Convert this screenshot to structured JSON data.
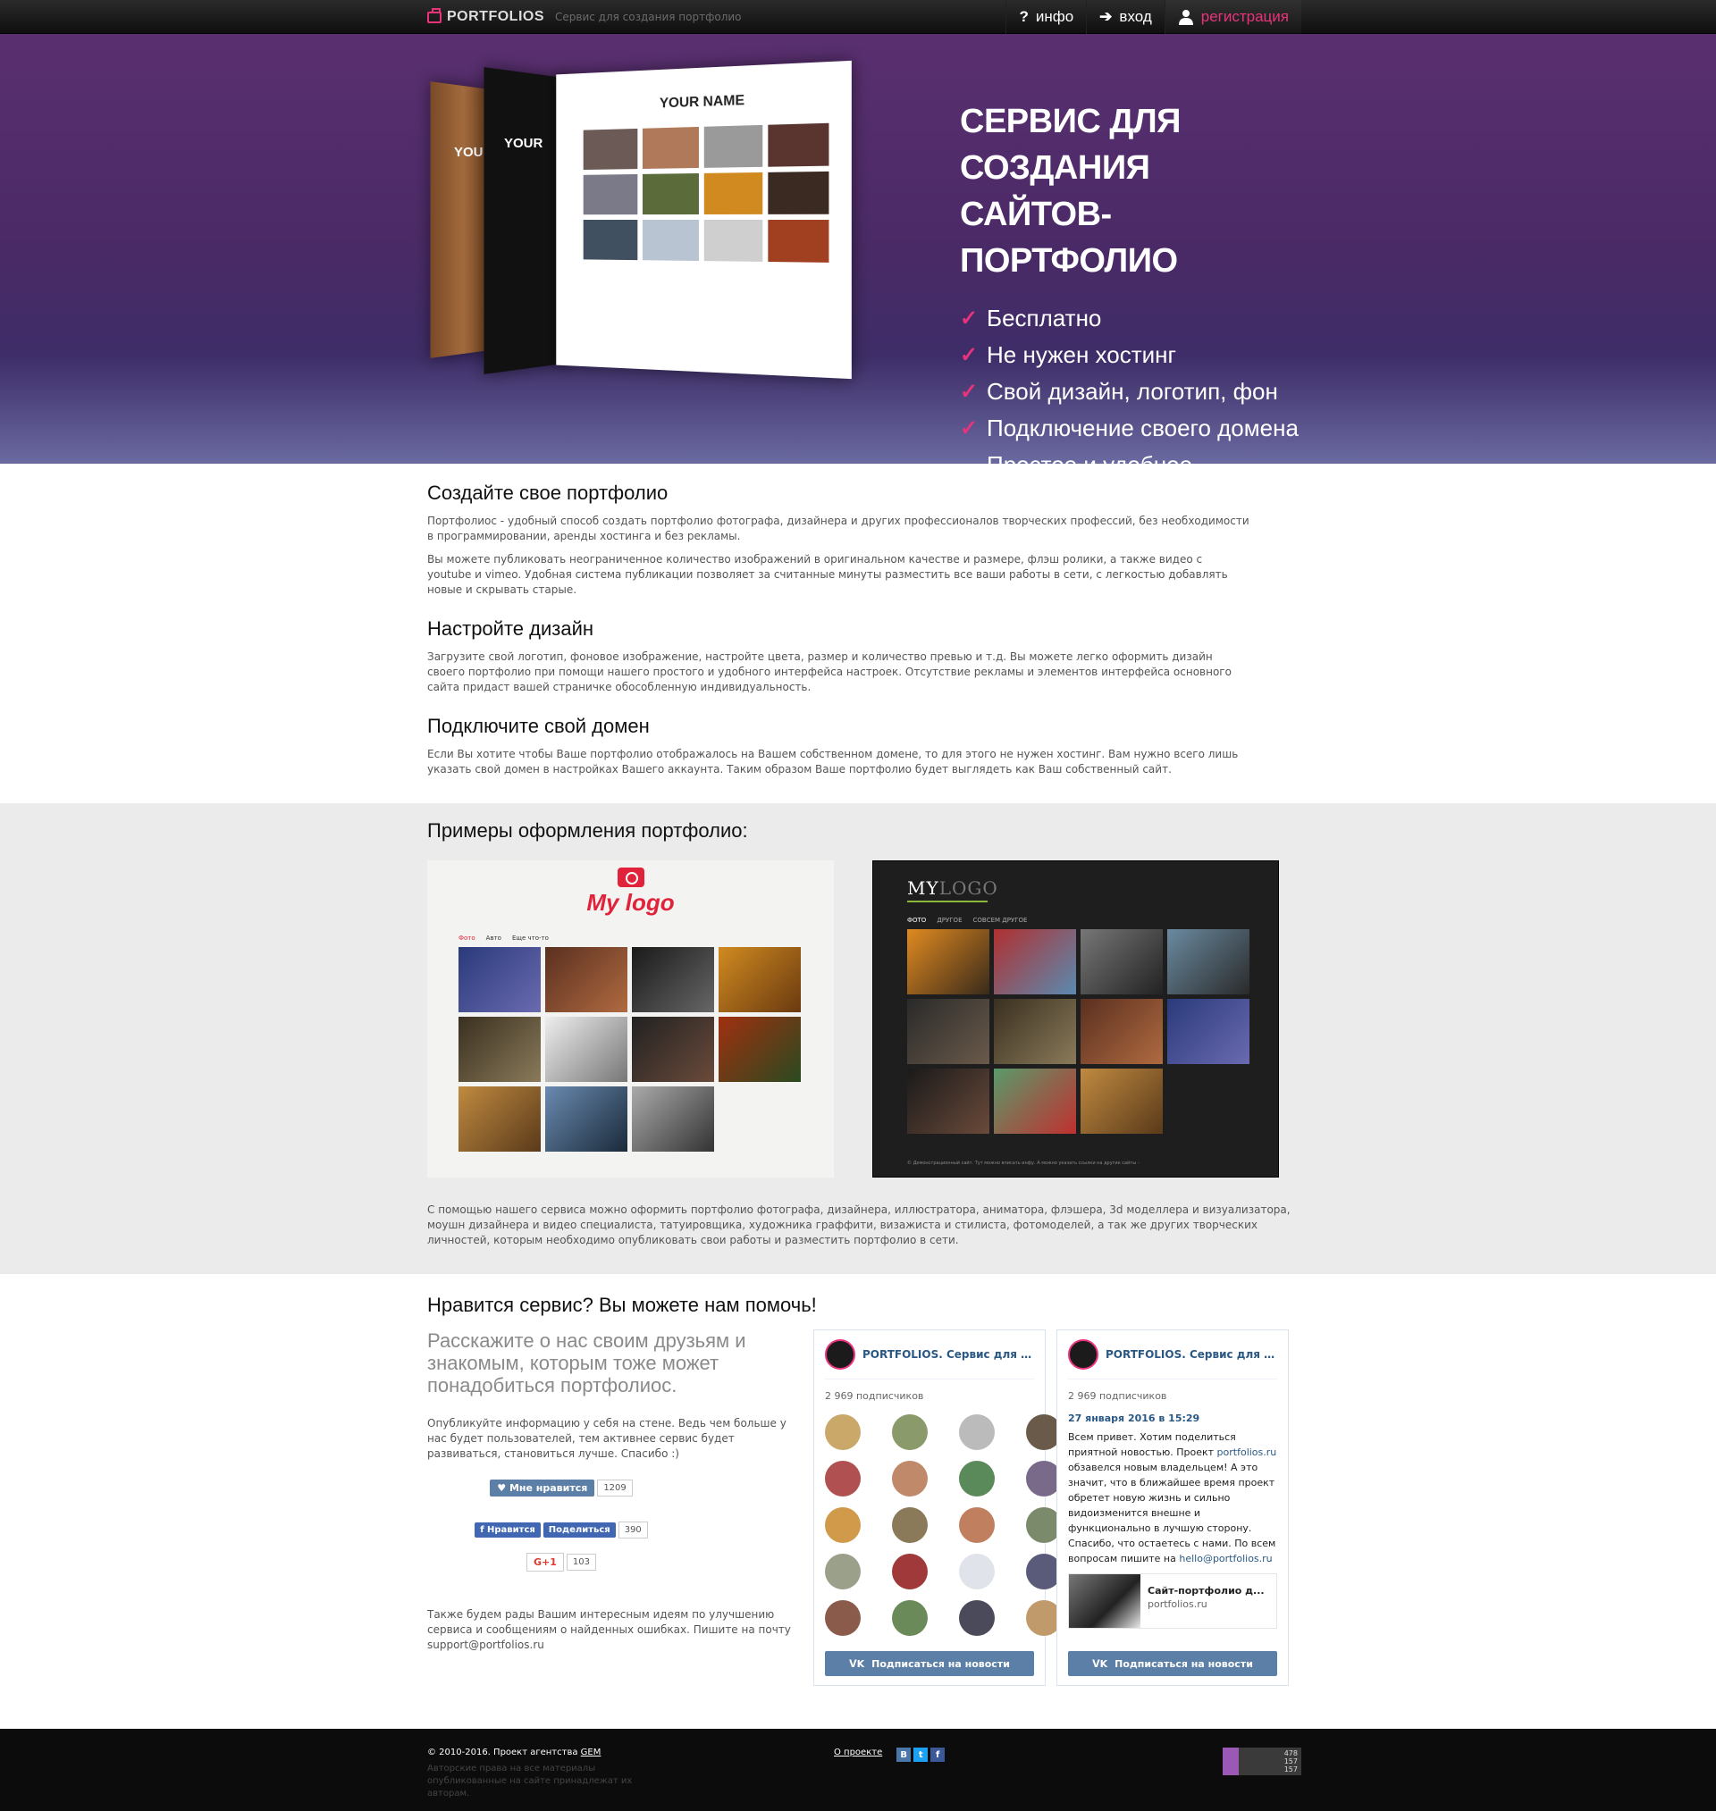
{
  "header": {
    "logo": "PORTFOLIOS",
    "tagline": "Сервис для создания портфолио",
    "nav": [
      {
        "label": "инфо",
        "icon": "?"
      },
      {
        "label": "вход",
        "icon": "➔"
      },
      {
        "label": "регистрация",
        "icon": "user-icon"
      }
    ]
  },
  "hero": {
    "title_line1": "СЕРВИС ДЛЯ СОЗДАНИЯ",
    "title_line2": "САЙТОВ-ПОРТФОЛИО",
    "features": [
      "Бесплатно",
      "Не нужен хостинг",
      "Свой дизайн, логотип, фон",
      "Подключение своего домена",
      "Простое и удобное управление"
    ],
    "mock_name": "YOUR NAME",
    "mock_your": "YOUR"
  },
  "about": [
    {
      "title": "Создайте свое портфолио",
      "paragraphs": [
        "Портфолиос - удобный способ создать портфолио фотографа, дизайнера и других профессионалов творческих профессий, без необходимости в программировании, аренды хостинга и без рекламы.",
        "Вы можете публиковать неограниченное количество изображений в оригинальном качестве и размере, флэш ролики, а также видео с youtube и vimeo. Удобная система публикации позволяет за считанные минуты разместить все ваши работы в сети, с легкостью добавлять новые и скрывать старые."
      ]
    },
    {
      "title": "Настройте дизайн",
      "paragraphs": [
        "Загрузите свой логотип, фоновое изображение, настройте цвета, размер и количество превью и т.д. Вы можете легко оформить дизайн своего портфолио при помощи нашего простого и удобного интерфейса настроек. Отсутствие рекламы и элементов интерфейса основного сайта придаст вашей страничке обособленную индивидуальность."
      ]
    },
    {
      "title": "Подключите свой домен",
      "paragraphs": [
        "Если Вы хотите чтобы Ваше портфолио отображалось на Вашем собственном домене, то для этого не нужен хостинг. Вам нужно всего лишь указать свой домен в настройках Вашего аккаунта. Таким образом Ваше портфолио будет выглядеть как Ваш собственный сайт."
      ]
    }
  ],
  "examples": {
    "title": "Примеры оформления портфолио:",
    "light": {
      "logo": "My logo",
      "menu": [
        "Фото",
        "Авто",
        "Еще что-то"
      ]
    },
    "dark": {
      "logo_a": "MY",
      "logo_b": "LOGO",
      "menu": [
        "ФОТО",
        "ДРУГОЕ",
        "СОВСЕМ ДРУГОЕ"
      ],
      "footer": "© Демонстрационный сайт. Тут можно вписать инфу. А можно указать ссылки на другие сайты -"
    },
    "description": "С помощью нашего сервиса можно оформить портфолио фотографа, дизайнера, иллюстратора, аниматора, флэшера, 3d моделлера и визуализатора, моушн дизайнера и видео специалиста, татуировщика, художника граффити, визажиста и стилиста, фотомоделей, а так же других творческих личностей, которым необходимо опубликовать свои работы и разместить портфолио в сети."
  },
  "help": {
    "title": "Нравится сервис? Вы можете нам помочь!",
    "lead": "Расскажите о нас своим друзьям и знакомым, которым тоже может понадобиться портфолиос.",
    "text1": "Опубликуйте информацию у себя на стене. Ведь чем больше у нас будет пользователей, тем активнее сервис будет развиваться, становиться лучше. Спасибо :)",
    "vk_like": "Мне нравится",
    "vk_count": "1209",
    "fb_like": "Нравится",
    "fb_share": "Поделиться",
    "fb_count": "390",
    "gplus": "G+1",
    "gplus_count": "103",
    "text2": "Также будем рады Вашим интересным идеям по улучшению сервиса и сообщениям о найденных ошибках. Пишите на почту support@portfolios.ru"
  },
  "widget": {
    "name": "PORTFOLIOS. Сервис для соз...",
    "subscribers": "2 969 подписчиков",
    "subscribe": "Подписаться на новости",
    "post_date": "27 января 2016 в 15:29",
    "post_a": "Всем привет. Хотим поделиться приятной новостью. Проект ",
    "post_link1": "portfolios.ru",
    "post_b": " обзавелся новым владельцем! А это значит, что в ближайшее время проект обретет новую жизнь и сильно видоизменится внешне и функционально в лучшую сторону. Спасибо, что остаетесь с нами. По всем вопросам пишите на ",
    "post_link2": "hello@portfolios.ru",
    "card_title": "Сайт-портфолио д...",
    "card_site": "portfolios.ru"
  },
  "footer": {
    "copy": "© 2010-2016. Проект агентства ",
    "agency": "GEM",
    "rights": "Авторские права на все материалы опубликованные на сайте принадлежат их авторам.",
    "about": "О проекте",
    "counter": [
      "478",
      "157",
      "157"
    ]
  },
  "colors": {
    "accent": "#e8337b",
    "vk": "#5b7fa6",
    "fb": "#4267b2"
  }
}
